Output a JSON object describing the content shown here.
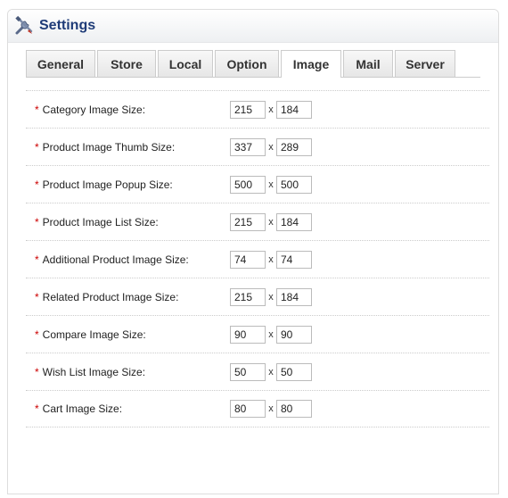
{
  "header": {
    "title": "Settings",
    "icon": "tools-icon"
  },
  "tabs": [
    {
      "label": "General",
      "active": false
    },
    {
      "label": "Store",
      "active": false
    },
    {
      "label": "Local",
      "active": false
    },
    {
      "label": "Option",
      "active": false
    },
    {
      "label": "Image",
      "active": true
    },
    {
      "label": "Mail",
      "active": false
    },
    {
      "label": "Server",
      "active": false
    }
  ],
  "form": {
    "required_mark": "*",
    "separator": "x",
    "rows": [
      {
        "label": "Category Image Size:",
        "width": "215",
        "height": "184"
      },
      {
        "label": "Product Image Thumb Size:",
        "width": "337",
        "height": "289"
      },
      {
        "label": "Product Image Popup Size:",
        "width": "500",
        "height": "500"
      },
      {
        "label": "Product Image List Size:",
        "width": "215",
        "height": "184"
      },
      {
        "label": "Additional Product Image Size:",
        "width": "74",
        "height": "74"
      },
      {
        "label": "Related Product Image Size:",
        "width": "215",
        "height": "184"
      },
      {
        "label": "Compare Image Size:",
        "width": "90",
        "height": "90"
      },
      {
        "label": "Wish List Image Size:",
        "width": "50",
        "height": "50"
      },
      {
        "label": "Cart Image Size:",
        "width": "80",
        "height": "80"
      }
    ]
  }
}
